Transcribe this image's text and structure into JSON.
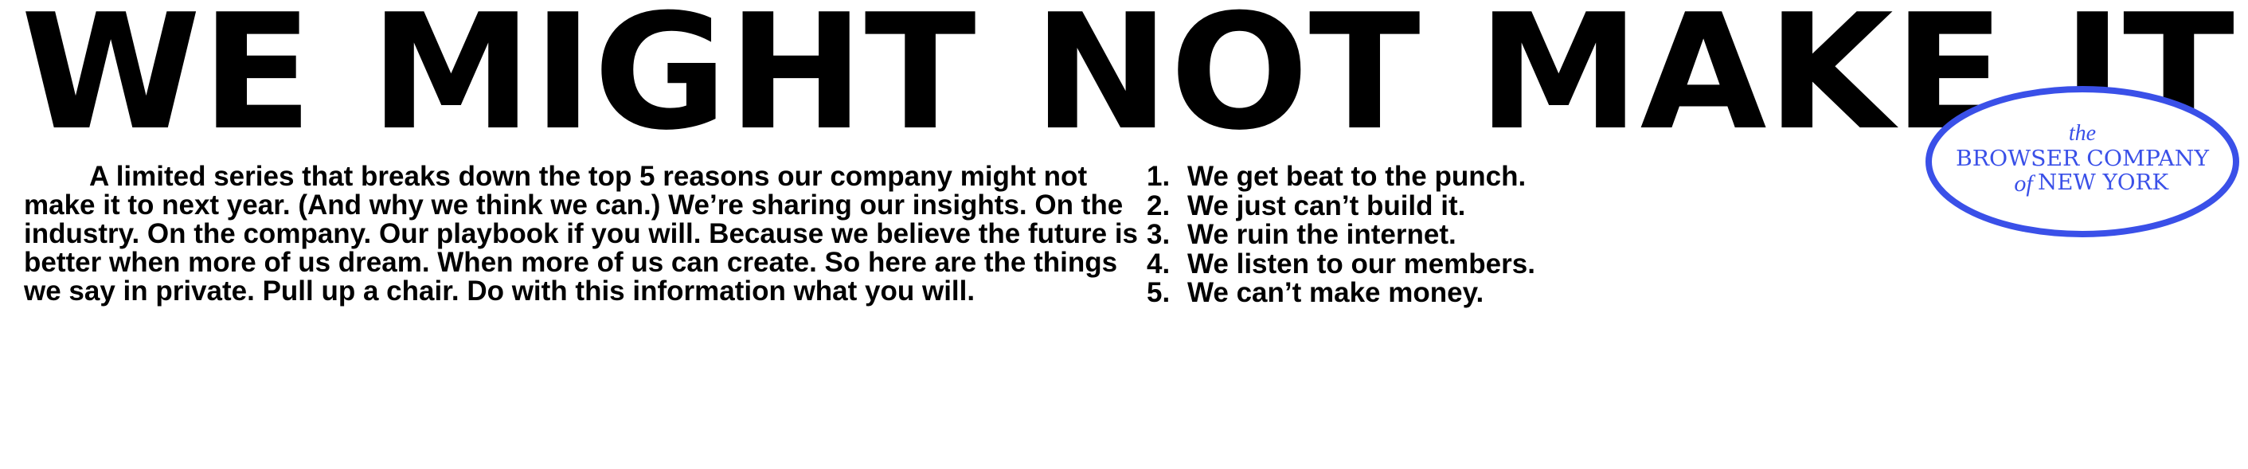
{
  "headline": "WE MIGHT NOT MAKE IT",
  "intro": "A limited series that breaks down the top 5 reasons our company might not make it to next year. (And why we think we can.) We’re sharing our insights. On the industry. On the company. Our playbook if you will. Because we believe the future is better when more of us dream. When more of us can create. So here are the things we say in private. Pull up a chair. Do with this information what you will.",
  "reasons": [
    {
      "num": "1.",
      "text": "We get beat to the punch."
    },
    {
      "num": "2.",
      "text": "We just can’t build it."
    },
    {
      "num": "3.",
      "text": "We ruin the internet."
    },
    {
      "num": "4.",
      "text": "We listen to our members."
    },
    {
      "num": "5.",
      "text": "We can’t make money."
    }
  ],
  "logo": {
    "the": "the",
    "line1": "BROWSER COMPANY",
    "of": "of",
    "line2": "NEW YORK"
  },
  "colors": {
    "text": "#000000",
    "background": "#ffffff",
    "brand": "#3a50e8"
  }
}
